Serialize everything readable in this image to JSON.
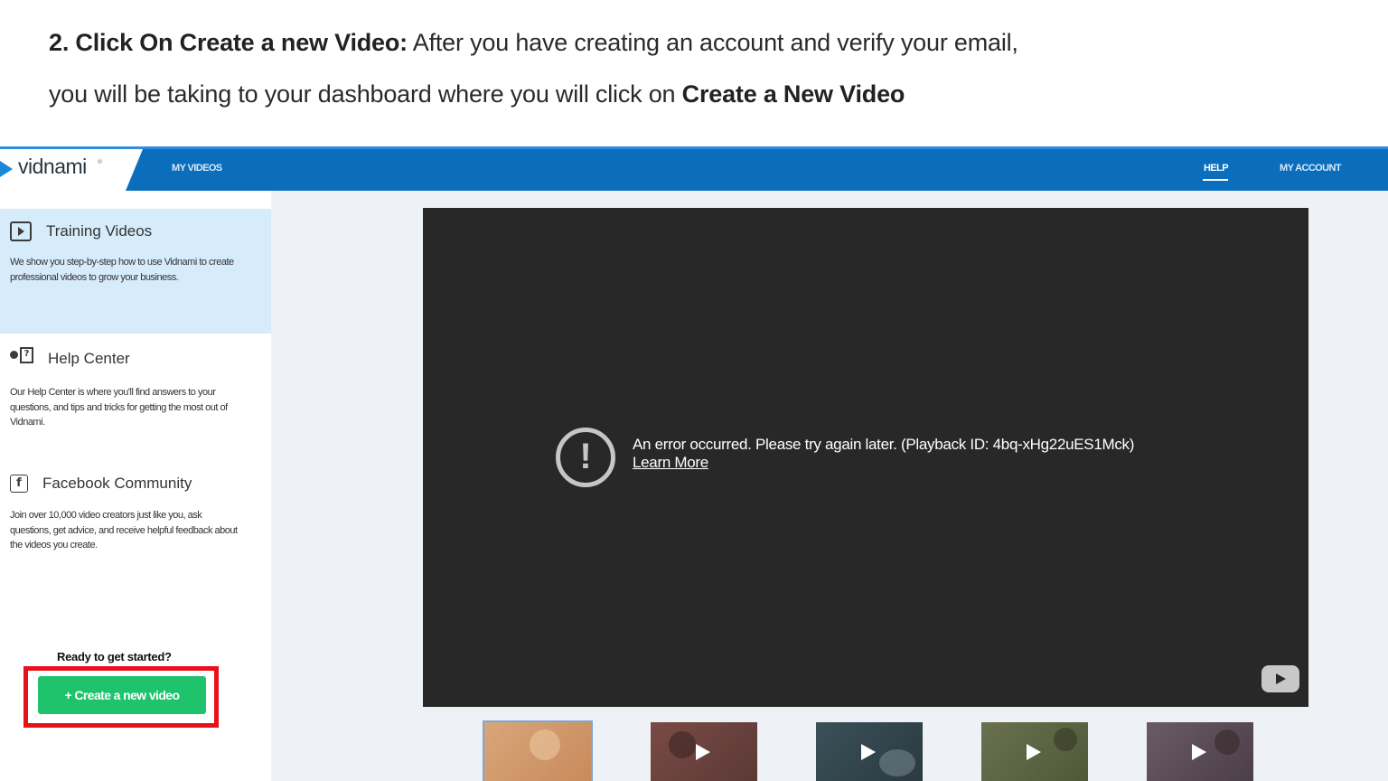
{
  "instruction": {
    "step_bold": "2. Click On Create a new Video:",
    "line1_rest": " After you have creating an account and verify your email,",
    "line2_text": "you will be taking to your dashboard where you will click on ",
    "line2_bold": "Create a New Video"
  },
  "app": {
    "logo_text": "vidnami",
    "logo_reg": "®",
    "nav": {
      "my_videos": "MY VIDEOS",
      "help": "HELP",
      "my_account": "MY ACCOUNT"
    },
    "sidebar": {
      "cards": [
        {
          "icon": "video-play-icon",
          "title": "Training Videos",
          "desc": "We show you step-by-step how to use Vidnami to create professional videos to grow your business."
        },
        {
          "icon": "help-person-icon",
          "title": "Help Center",
          "desc": "Our Help Center is where you'll find answers to your questions, and tips and tricks for getting the most out of Vidnami."
        },
        {
          "icon": "facebook-icon",
          "title": "Facebook Community",
          "desc": "Join over 10,000 video creators just like you, ask questions, get advice, and receive helpful feedback about the videos you create."
        }
      ],
      "ready_text": "Ready to get started?",
      "create_button": "+ Create a new video"
    },
    "player": {
      "error_text": "An error occurred. Please try again later. (Playback ID: 4bq-xHg22uES1Mck)",
      "learn_more": "Learn More"
    },
    "colors": {
      "nav_blue": "#0a6ebd",
      "create_green": "#1ec36b",
      "highlight_red": "#e8101a",
      "active_card_bg": "#d6ecfb"
    }
  }
}
